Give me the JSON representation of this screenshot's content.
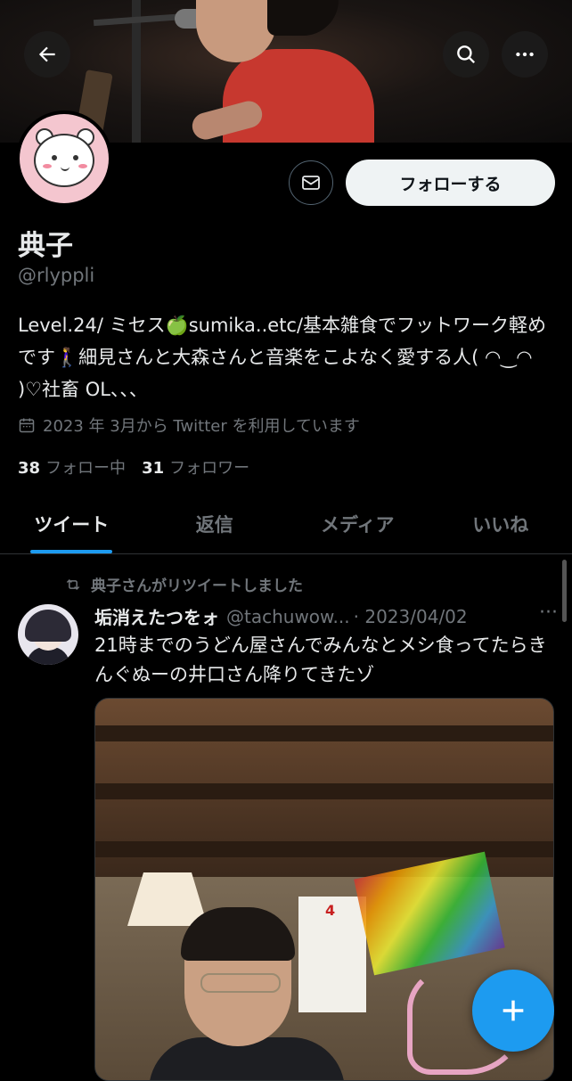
{
  "header": {
    "back_icon": "arrow-left-icon",
    "search_icon": "search-icon",
    "more_icon": "more-horizontal-icon"
  },
  "profile": {
    "name": "典子",
    "handle": "@rlyppli",
    "bio": "Level.24/ ミセス🍏sumika..etc/基本雑食でフットワーク軽めです🚶‍♀️細見さんと大森さんと音楽をこよなく愛する人( ◠‿◠ )♡社畜 OL、、、",
    "joined": "2023 年 3月から Twitter を利用しています",
    "following_count": "38",
    "following_label": "フォロー中",
    "followers_count": "31",
    "followers_label": "フォロワー",
    "follow_button": "フォローする"
  },
  "tabs": [
    {
      "label": "ツイート",
      "active": true
    },
    {
      "label": "返信",
      "active": false
    },
    {
      "label": "メディア",
      "active": false
    },
    {
      "label": "いいね",
      "active": false
    }
  ],
  "tweet": {
    "retweet_label": "典子さんがリツイートしました",
    "author_name": "垢消えたつをォ",
    "author_handle": "@tachuwow...",
    "date": "· 2023/04/02",
    "more": "···",
    "text": "21時までのうどん屋さんでみんなとメシ食ってたらきんぐぬーの井口さん降りてきたゾ"
  },
  "colors": {
    "accent": "#1d9bf0",
    "background": "#000000",
    "secondary_text": "#71767b"
  },
  "fab_icon": "plus-icon"
}
